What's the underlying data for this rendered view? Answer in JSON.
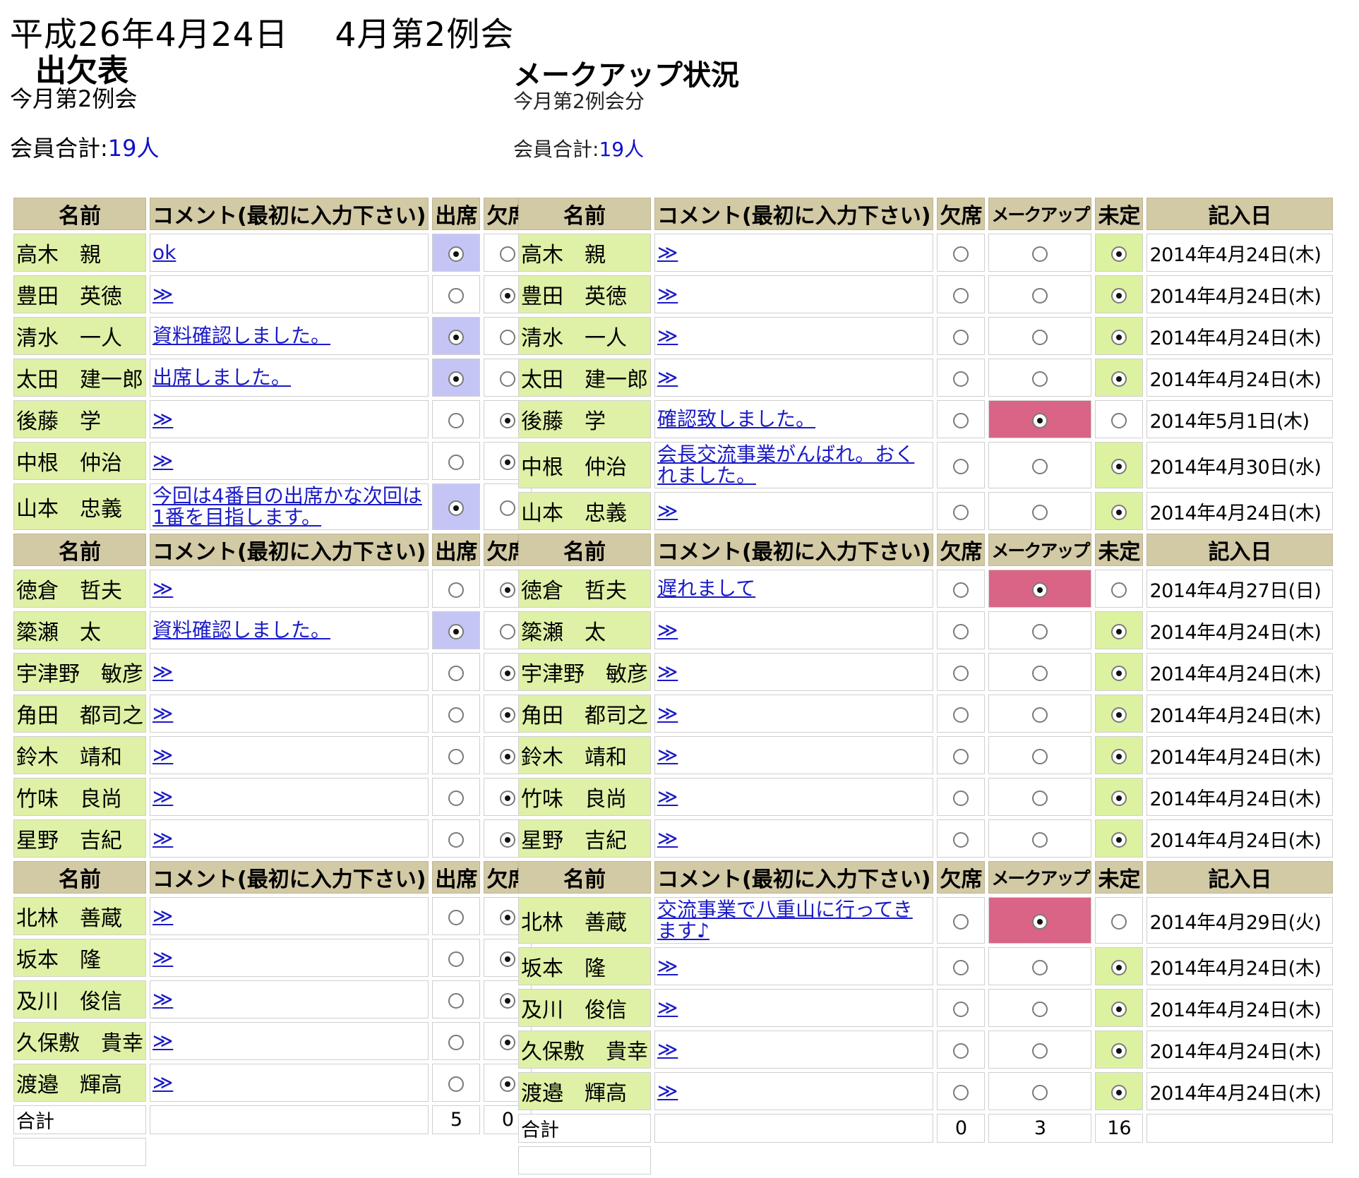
{
  "header": {
    "date": "平成26年4月24日",
    "meeting": "4月第2例会",
    "attendance_title": "出欠表",
    "attendance_sub": "今月第2例会",
    "makeup_title": "メークアップ状況",
    "makeup_sub": "今月第2例会分",
    "member_total_label": "会員合計:",
    "member_total_count": "19人"
  },
  "attendance": {
    "headers": {
      "name": "名前",
      "comment": "コメント(最初に入力下さい)",
      "present": "出席",
      "absent": "欠席"
    },
    "groups": [
      [
        {
          "name": "高木　親",
          "comment": "ok",
          "present": true
        },
        {
          "name": "豊田　英徳",
          "comment": "≫",
          "present": false
        },
        {
          "name": "清水　一人",
          "comment": "資料確認しました。",
          "present": true
        },
        {
          "name": "太田　建一郎",
          "comment": "出席しました。",
          "present": true
        },
        {
          "name": "後藤　学",
          "comment": "≫",
          "present": false
        },
        {
          "name": "中根　仲治",
          "comment": "≫",
          "present": false
        },
        {
          "name": "山本　忠義",
          "comment": "今回は4番目の出席かな次回は1番を目指します。",
          "present": true,
          "tall": true
        }
      ],
      [
        {
          "name": "徳倉　哲夫",
          "comment": "≫",
          "present": false
        },
        {
          "name": "簗瀬　太",
          "comment": "資料確認しました。",
          "present": true
        },
        {
          "name": "宇津野　敏彦",
          "comment": "≫",
          "present": false
        },
        {
          "name": "角田　都司之",
          "comment": "≫",
          "present": false
        },
        {
          "name": "鈴木　靖和",
          "comment": "≫",
          "present": false
        },
        {
          "name": "竹味　良尚",
          "comment": "≫",
          "present": false
        },
        {
          "name": "星野　吉紀",
          "comment": "≫",
          "present": false
        }
      ],
      [
        {
          "name": "北林　善蔵",
          "comment": "≫",
          "present": false
        },
        {
          "name": "坂本　隆",
          "comment": "≫",
          "present": false
        },
        {
          "name": "及川　俊信",
          "comment": "≫",
          "present": false
        },
        {
          "name": "久保敷　貴幸",
          "comment": "≫",
          "present": false
        },
        {
          "name": "渡邉　輝高",
          "comment": "≫",
          "present": false
        }
      ]
    ],
    "total_label": "合計",
    "total_present": "5",
    "total_absent": "0"
  },
  "makeup": {
    "headers": {
      "name": "名前",
      "comment": "コメント(最初に入力下さい)",
      "absent": "欠席",
      "makeup": "メークアップ",
      "undecided": "未定",
      "date": "記入日"
    },
    "groups": [
      [
        {
          "name": "高木　親",
          "comment": "≫",
          "status": "undecided",
          "date": "2014年4月24日(木)"
        },
        {
          "name": "豊田　英徳",
          "comment": "≫",
          "status": "undecided",
          "date": "2014年4月24日(木)"
        },
        {
          "name": "清水　一人",
          "comment": "≫",
          "status": "undecided",
          "date": "2014年4月24日(木)"
        },
        {
          "name": "太田　建一郎",
          "comment": "≫",
          "status": "undecided",
          "date": "2014年4月24日(木)"
        },
        {
          "name": "後藤　学",
          "comment": "確認致しました。",
          "status": "makeup",
          "date": "2014年5月1日(木)"
        },
        {
          "name": "中根　仲治",
          "comment": "会長交流事業がんばれ。おくれました。",
          "status": "undecided",
          "date": "2014年4月30日(水)",
          "tall": true
        },
        {
          "name": "山本　忠義",
          "comment": "≫",
          "status": "undecided",
          "date": "2014年4月24日(木)"
        }
      ],
      [
        {
          "name": "徳倉　哲夫",
          "comment": "遅れまして",
          "status": "makeup",
          "date": "2014年4月27日(日)"
        },
        {
          "name": "簗瀬　太",
          "comment": "≫",
          "status": "undecided",
          "date": "2014年4月24日(木)"
        },
        {
          "name": "宇津野　敏彦",
          "comment": "≫",
          "status": "undecided",
          "date": "2014年4月24日(木)"
        },
        {
          "name": "角田　都司之",
          "comment": "≫",
          "status": "undecided",
          "date": "2014年4月24日(木)"
        },
        {
          "name": "鈴木　靖和",
          "comment": "≫",
          "status": "undecided",
          "date": "2014年4月24日(木)"
        },
        {
          "name": "竹味　良尚",
          "comment": "≫",
          "status": "undecided",
          "date": "2014年4月24日(木)"
        },
        {
          "name": "星野　吉紀",
          "comment": "≫",
          "status": "undecided",
          "date": "2014年4月24日(木)"
        }
      ],
      [
        {
          "name": "北林　善蔵",
          "comment": "交流事業で八重山に行ってきます♪",
          "status": "makeup",
          "date": "2014年4月29日(火)",
          "tall": true
        },
        {
          "name": "坂本　隆",
          "comment": "≫",
          "status": "undecided",
          "date": "2014年4月24日(木)"
        },
        {
          "name": "及川　俊信",
          "comment": "≫",
          "status": "undecided",
          "date": "2014年4月24日(木)"
        },
        {
          "name": "久保敷　貴幸",
          "comment": "≫",
          "status": "undecided",
          "date": "2014年4月24日(木)"
        },
        {
          "name": "渡邉　輝高",
          "comment": "≫",
          "status": "undecided",
          "date": "2014年4月24日(木)"
        }
      ]
    ],
    "total_label": "合計",
    "total_absent": "0",
    "total_makeup": "3",
    "total_undecided": "16"
  },
  "colors": {
    "header_bg": "#d2c9a5",
    "name_bg": "#dff1a6",
    "present_selected": "#c5c5f5",
    "undecided_selected": "#dcf2a0",
    "makeup_selected": "#d96486",
    "link": "#1a1ac8"
  }
}
